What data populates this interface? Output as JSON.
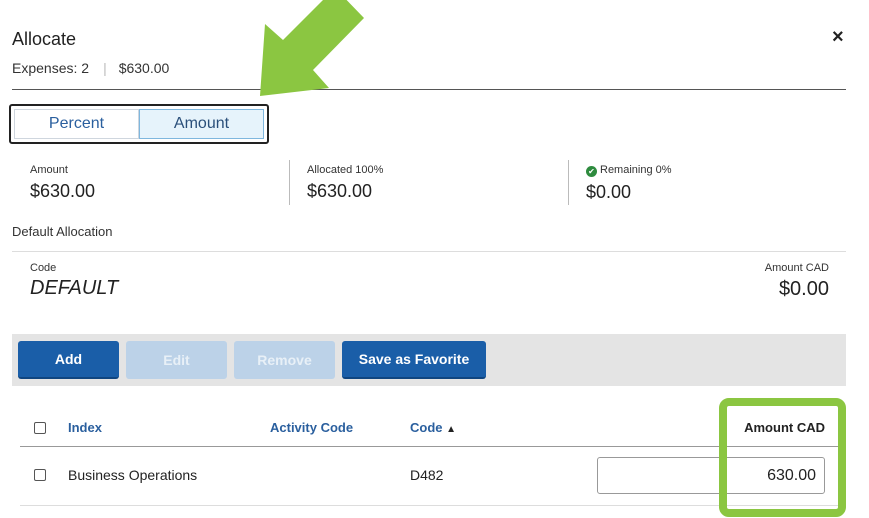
{
  "dialog": {
    "title": "Allocate",
    "expenses_label": "Expenses: 2",
    "separator": "|",
    "total": "$630.00",
    "close_glyph": "×"
  },
  "toggle": {
    "options": [
      "Percent",
      "Amount"
    ],
    "selected": "Amount"
  },
  "summary": {
    "amount_label": "Amount",
    "amount_value": "$630.00",
    "allocated_label": "Allocated 100%",
    "allocated_value": "$630.00",
    "remaining_label": "Remaining 0%",
    "remaining_value": "$0.00",
    "remaining_icon": "check-circle-icon"
  },
  "default_allocation": {
    "title": "Default Allocation",
    "code_label": "Code",
    "code_value": "DEFAULT",
    "amount_label": "Amount CAD",
    "amount_value": "$0.00"
  },
  "toolbar": {
    "add": "Add",
    "edit": "Edit",
    "remove": "Remove",
    "save_favorite": "Save as Favorite"
  },
  "table": {
    "headers": {
      "index": "Index",
      "activity_code": "Activity Code",
      "code": "Code",
      "code_sort_glyph": "▲",
      "amount": "Amount CAD"
    },
    "rows": [
      {
        "index": "Business Operations",
        "activity_code": "",
        "code": "D482",
        "amount_text": "",
        "amount": "630.00"
      }
    ]
  },
  "annotations": {
    "arrow_color": "#8bc641",
    "highlight_color": "#8bc641"
  }
}
